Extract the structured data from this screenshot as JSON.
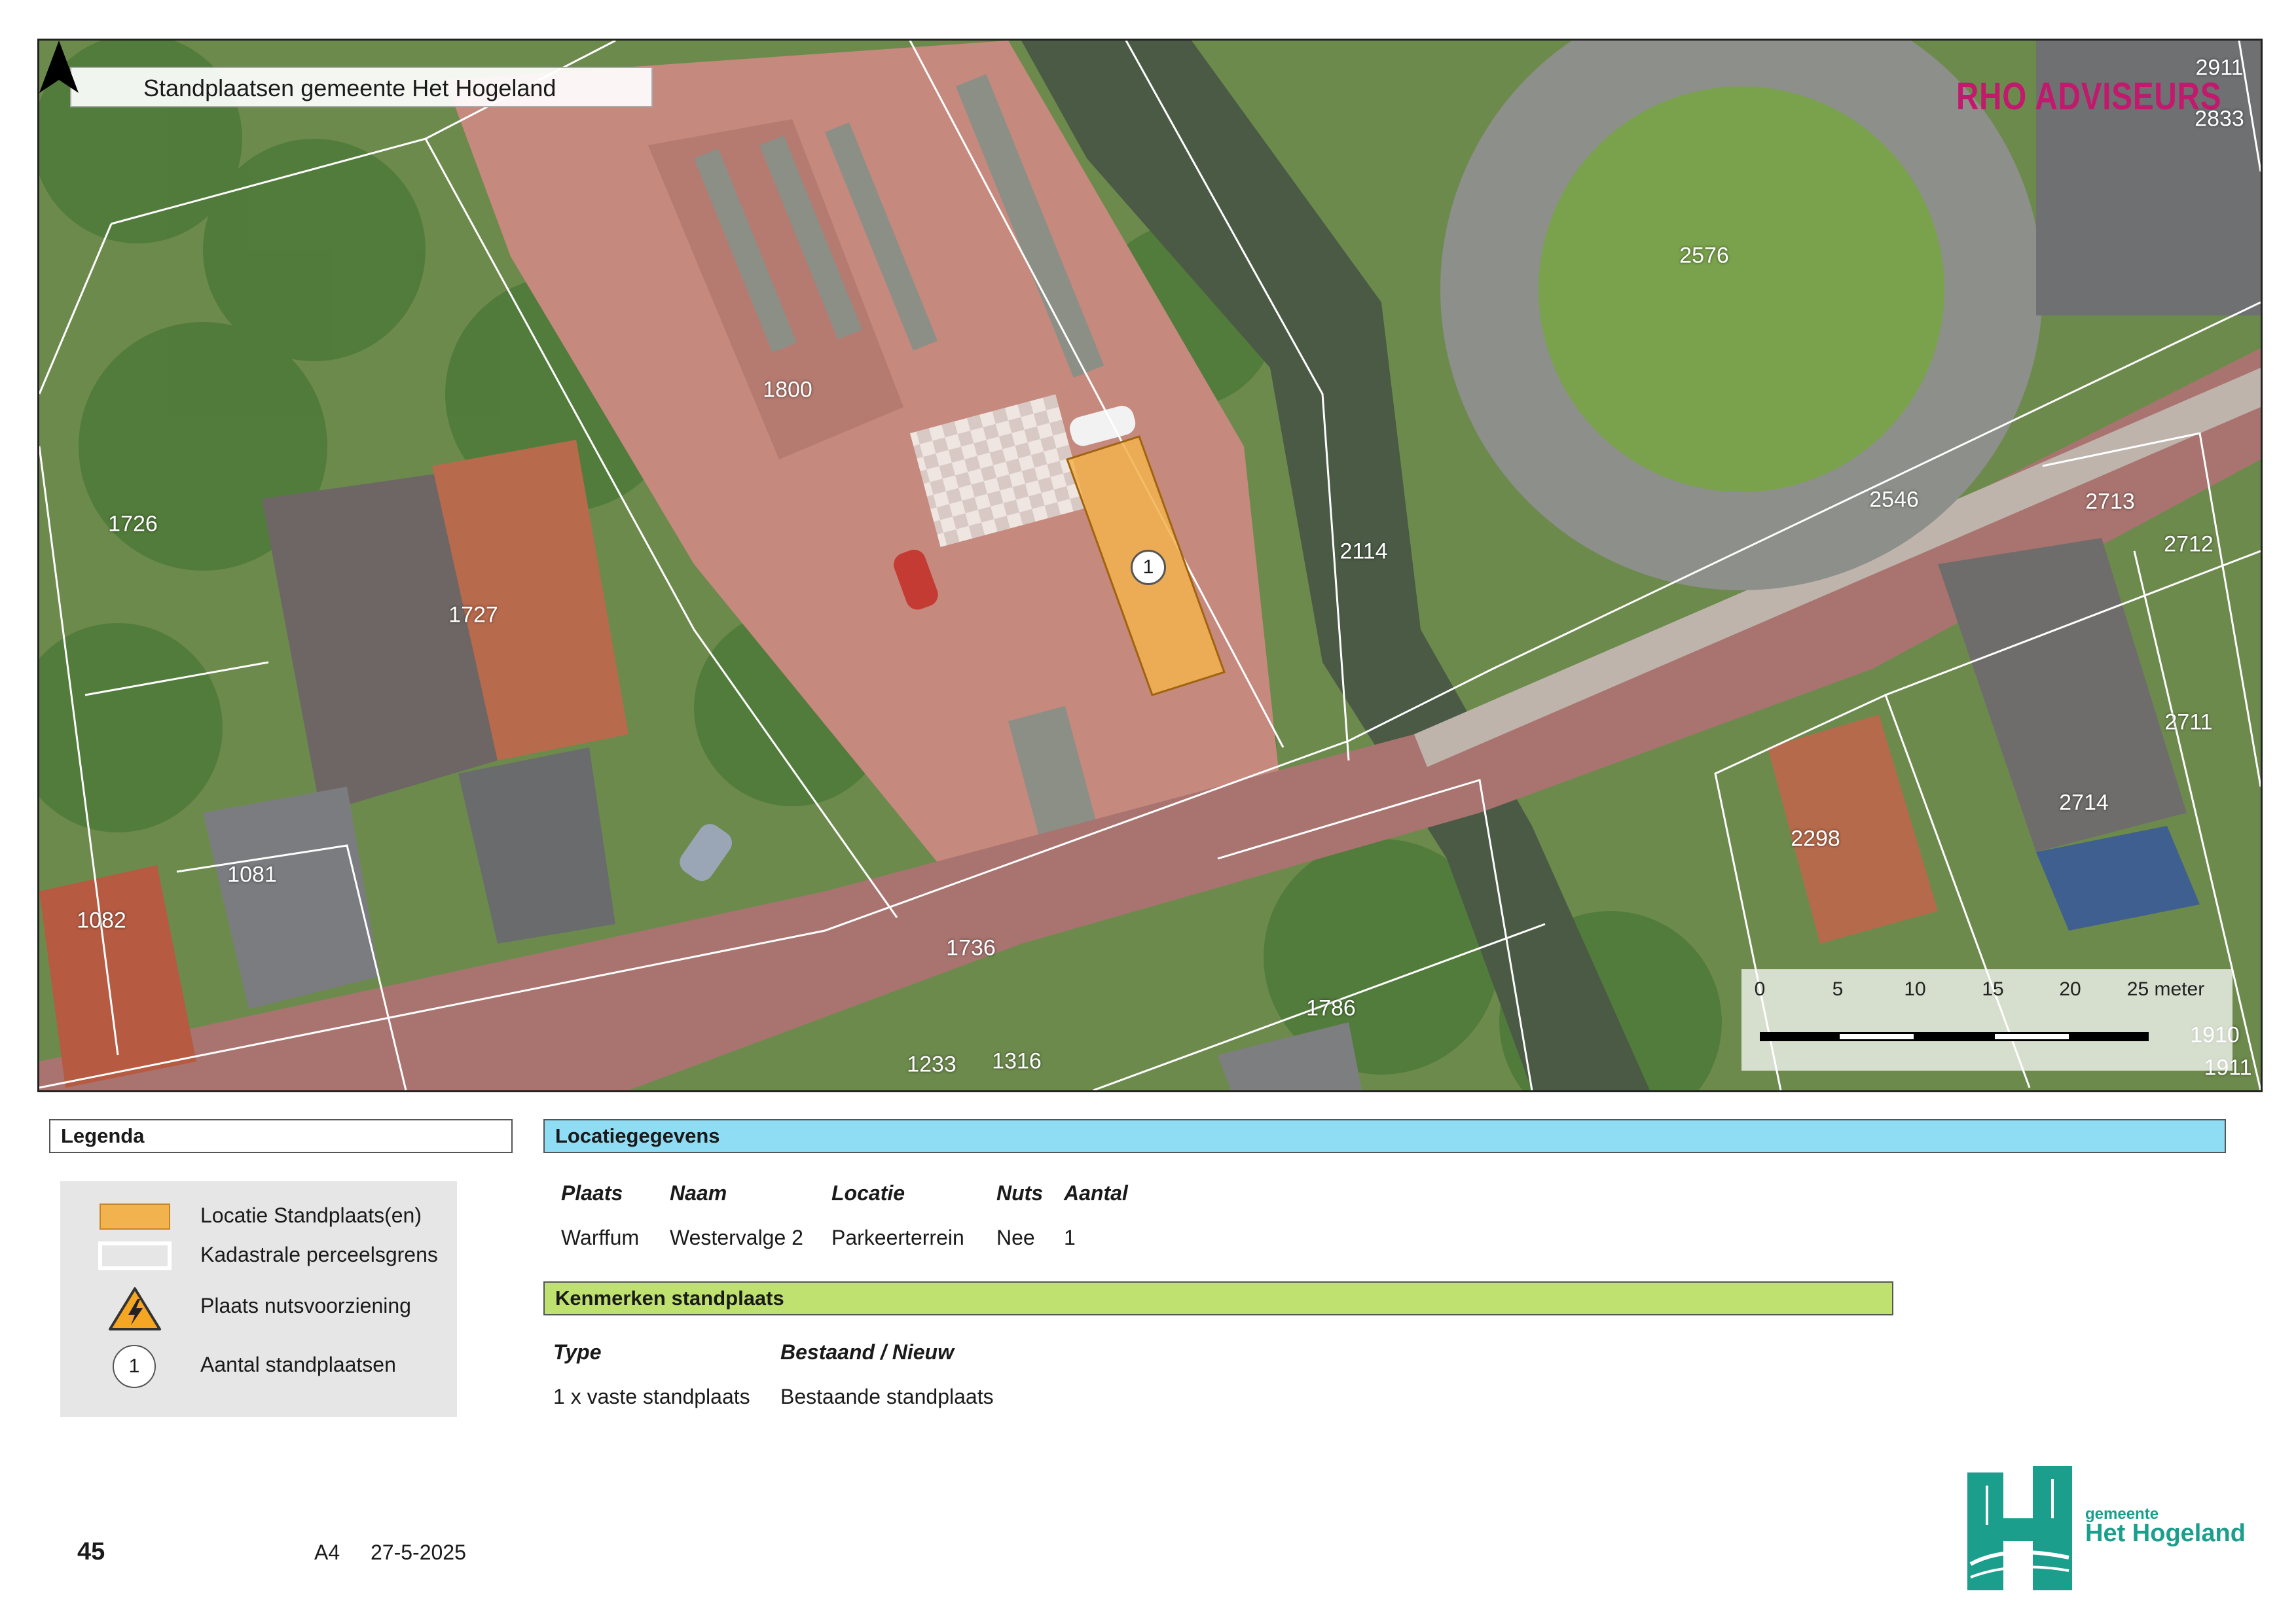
{
  "map": {
    "title": "Standplaatsen gemeente Het Hogeland",
    "brand": "RHO ADVISEURS",
    "parcels": [
      "2911",
      "2833",
      "2576",
      "1800",
      "1726",
      "1727",
      "2114",
      "2546",
      "2713",
      "2712",
      "2711",
      "2714",
      "2298",
      "1081",
      "1082",
      "1736",
      "1786",
      "1233",
      "1316",
      "1910",
      "1911"
    ],
    "marker_count": "1",
    "scale": {
      "ticks": [
        "0",
        "5",
        "10",
        "15",
        "20",
        "25 meter"
      ]
    }
  },
  "legend": {
    "title": "Legenda",
    "items": [
      {
        "label": "Locatie Standplaats(en)",
        "icon": "orange-rectangle-icon"
      },
      {
        "label": "Kadastrale perceelsgrens",
        "icon": "white-outline-icon"
      },
      {
        "label": "Plaats nutsvoorziening",
        "icon": "high-voltage-warning-icon"
      },
      {
        "label": "Aantal standplaatsen",
        "icon": "count-circle-icon",
        "symbol": "1"
      }
    ]
  },
  "locatiegegevens": {
    "title": "Locatiegegevens",
    "headers": [
      "Plaats",
      "Naam",
      "Locatie",
      "Nuts",
      "Aantal"
    ],
    "row": [
      "Warffum",
      "Westervalge 2",
      "Parkeerterrein",
      "Nee",
      "1"
    ]
  },
  "kenmerken": {
    "title": "Kenmerken standplaats",
    "headers": [
      "Type",
      "Bestaand / Nieuw"
    ],
    "row": [
      "1 x vaste standplaats",
      "Bestaande standplaats"
    ]
  },
  "footer": {
    "page_number": "45",
    "paper_size": "A4",
    "date": "27-5-2025",
    "municipality_small": "gemeente",
    "municipality_name": "Het Hogeland"
  },
  "colors": {
    "standplaats": "#f2b24e",
    "locatie_header": "#8fdcf5",
    "kenmerken_header": "#bfe16f",
    "brand": "#c2186e",
    "municipality": "#1c9e8c"
  }
}
